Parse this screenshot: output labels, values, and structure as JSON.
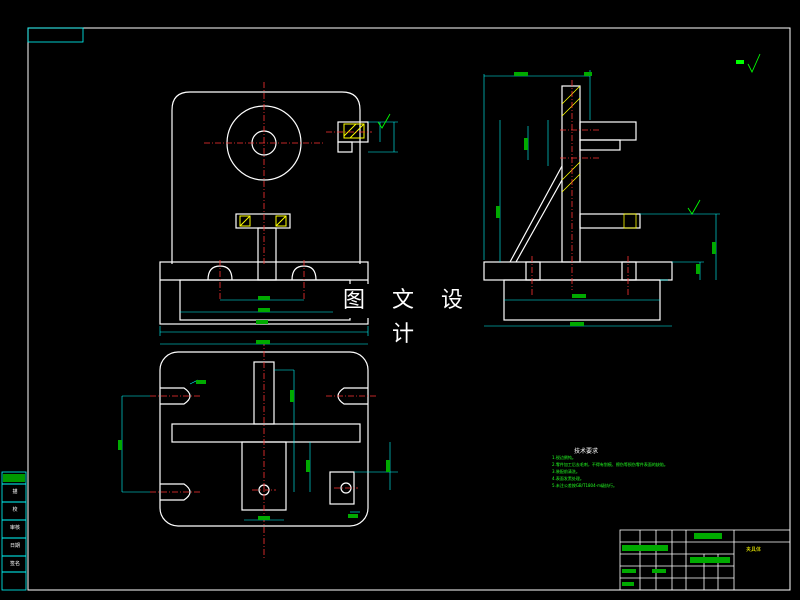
{
  "watermark": "图 文 设 计",
  "technical_requirements": {
    "title": "技术要求",
    "lines": [
      "1.锐边倒钝。",
      "2.零件加工后去毛刺，不得有划痕、擦伤等损伤零件表面的缺陷。",
      "3.装配前清洗。",
      "4.表面发黑处理。",
      "5.未注公差按GB/T1804-m级执行。"
    ]
  },
  "title_block": {
    "drawing_name": "夹具体"
  },
  "side_tags": [
    "描",
    "校",
    "审核",
    "日期",
    "签名"
  ],
  "colors": {
    "outline": "#ffffff",
    "frame": "#00ffff",
    "center": "#ff3030",
    "hatch": "#ffff00",
    "text": "#00ff00"
  }
}
